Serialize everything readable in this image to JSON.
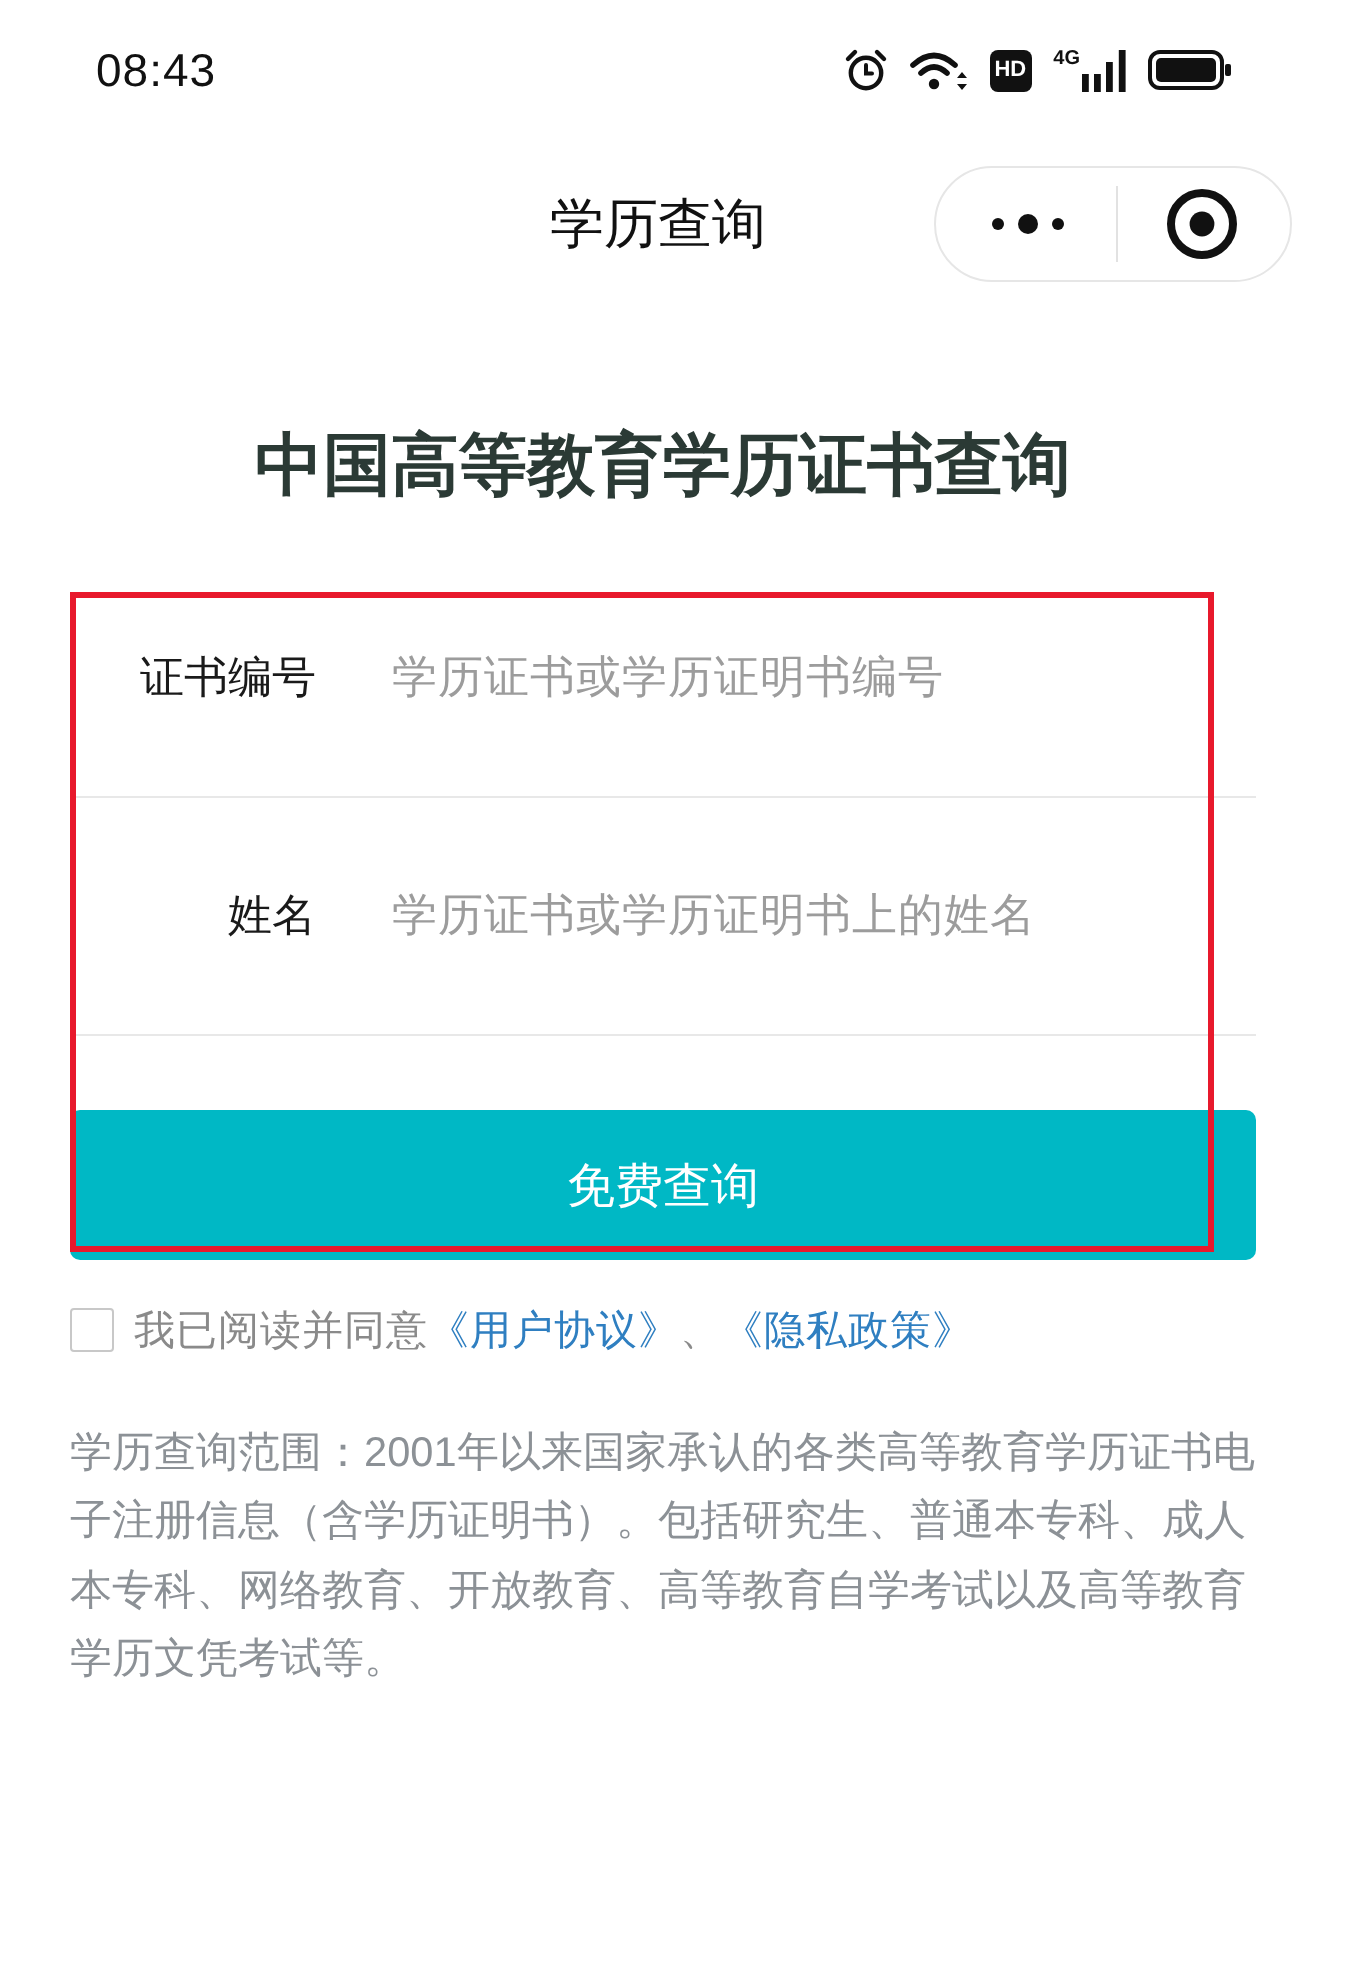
{
  "status_bar": {
    "time": "08:43",
    "hd": "HD",
    "network": "4G"
  },
  "nav_bar": {
    "title": "学历查询"
  },
  "heading": "中国高等教育学历证书查询",
  "form": {
    "fields": [
      {
        "label": "证书编号",
        "placeholder": "学历证书或学历证明书编号"
      },
      {
        "label": "姓名",
        "placeholder": "学历证书或学历证明书上的姓名"
      }
    ],
    "submit": "免费查询"
  },
  "agreement": {
    "checked": false,
    "text": "我已阅读并同意",
    "links": [
      "《用户协议》",
      "《隐私政策》"
    ],
    "separator": "、"
  },
  "scope_note": "学历查询范围：2001年以来国家承认的各类高等教育学历证书电子注册信息（含学历证明书）。包括研究生、普通本专科、成人本专科、网络教育、开放教育、高等教育自学考试以及高等教育学历文凭考试等。"
}
